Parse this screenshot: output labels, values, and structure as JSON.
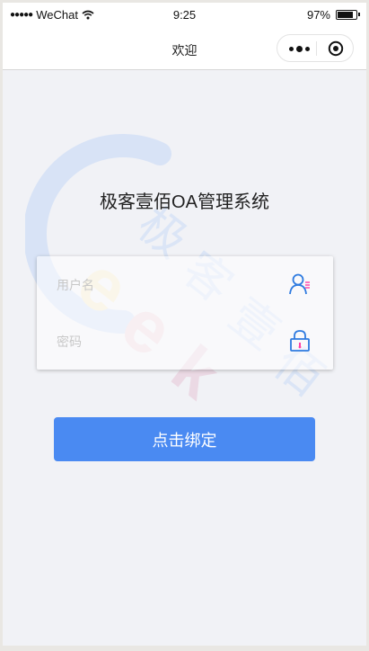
{
  "statusbar": {
    "signal": "●●●●●",
    "carrier": "WeChat",
    "time": "9:25",
    "battery": "97%",
    "battery_level": 0.97
  },
  "navbar": {
    "title": "欢迎"
  },
  "app": {
    "title": "极客壹佰OA管理系统"
  },
  "form": {
    "username_placeholder": "用户名",
    "username_value": "",
    "password_placeholder": "密码",
    "password_value": ""
  },
  "actions": {
    "bind_button": "点击绑定"
  },
  "watermark": {
    "latin": "Geek",
    "cjk": [
      "极",
      "客",
      "壹",
      "佰"
    ]
  },
  "colors": {
    "primary": "#4a8af2",
    "icon_blue": "#2f7be0",
    "icon_pink": "#ff3fa8",
    "background": "#f1f2f6"
  }
}
